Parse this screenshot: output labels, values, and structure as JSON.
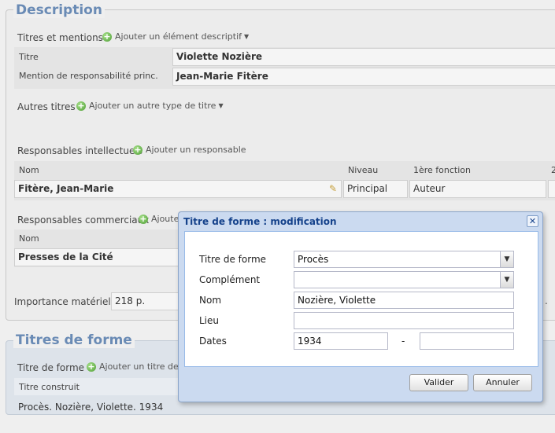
{
  "description": {
    "legend": "Description",
    "titres_mentions": {
      "label": "Titres et mentions",
      "add": "Ajouter un élément descriptif"
    },
    "titre": {
      "label": "Titre",
      "value": "Violette Nozière"
    },
    "mention": {
      "label": "Mention de responsabilité princ.",
      "value": "Jean-Marie Fitère"
    },
    "autres_titres": {
      "label": "Autres titres",
      "add": "Ajouter un autre type de titre"
    },
    "resp_intellectuels": {
      "label": "Responsables intellectuels",
      "add": "Ajouter un responsable",
      "columns": {
        "nom": "Nom",
        "niveau": "Niveau",
        "fonction": "1ère fonction",
        "extra": "2"
      },
      "row": {
        "nom": "Fitère, Jean-Marie",
        "niveau": "Principal",
        "fonction": "Auteur"
      }
    },
    "resp_commerciaux": {
      "label": "Responsables commerciaux",
      "add": "Ajouter",
      "column_nom": "Nom",
      "row_nom": "Presses de la Cité"
    },
    "importance": {
      "label": "Importance matérielle",
      "value": "218 p."
    }
  },
  "titres_de_forme": {
    "legend": "Titres de forme",
    "label": "Titre de forme",
    "add": "Ajouter un titre de for",
    "column": "Titre construit",
    "value": "Procès. Nozière, Violette. 1934"
  },
  "dialog": {
    "title": "Titre de forme : modification",
    "close_glyph": "✕",
    "fields": {
      "titre_forme": {
        "label": "Titre de forme",
        "value": "Procès"
      },
      "complement": {
        "label": "Complément",
        "value": ""
      },
      "nom": {
        "label": "Nom",
        "value": "Nozière, Violette"
      },
      "lieu": {
        "label": "Lieu",
        "value": ""
      },
      "dates": {
        "label": "Dates",
        "start": "1934",
        "separator": "-",
        "end": ""
      }
    },
    "buttons": {
      "valider": "Valider",
      "annuler": "Annuler"
    }
  },
  "colors": {
    "legend": "#6a8bb5",
    "dialog_title": "#15428b",
    "add_icon": "#4f9e35"
  }
}
